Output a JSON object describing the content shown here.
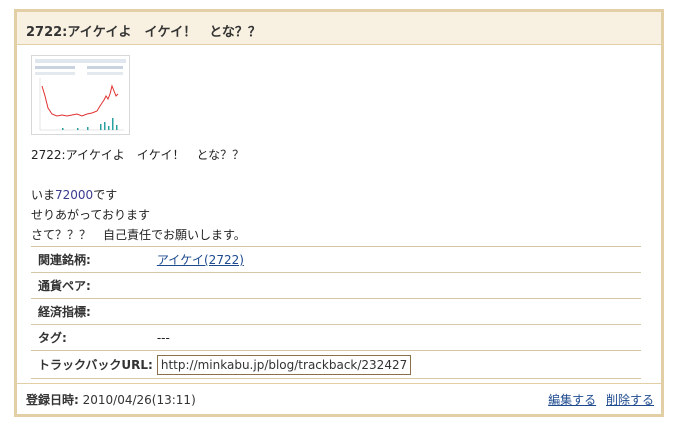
{
  "entry": {
    "title": "2722:アイケイよ　イケイ！　とな？？",
    "body_lines": [
      "2722:アイケイよ　イケイ！　とな？？",
      "",
      "いま",
      "72000",
      "です",
      "せりあがっております",
      "さて？？？　自己責任でお願いします。"
    ],
    "thumbnail": {
      "icon": "stock-chart-thumbnail",
      "accent_up": "#e03030",
      "accent_vol": "#2aa0a0"
    }
  },
  "meta": {
    "related_stock_label": "関連銘柄:",
    "related_stock_value": "アイケイ(2722)",
    "currency_pair_label": "通貨ペア:",
    "currency_pair_value": "",
    "economic_indicator_label": "経済指標:",
    "economic_indicator_value": "",
    "tags_label": "タグ:",
    "tags_value": "---",
    "trackback_label": "トラックバックURL:",
    "trackback_value": "http://minkabu.jp/blog/trackback/232427"
  },
  "footer": {
    "registered_label": "登録日時:",
    "registered_value": "2010/04/26(13:11)",
    "edit_label": "編集する",
    "delete_label": "削除する"
  },
  "colors": {
    "border": "#e2cfa6",
    "header_bg": "#f8f1e1",
    "link": "#1d4a8f"
  }
}
